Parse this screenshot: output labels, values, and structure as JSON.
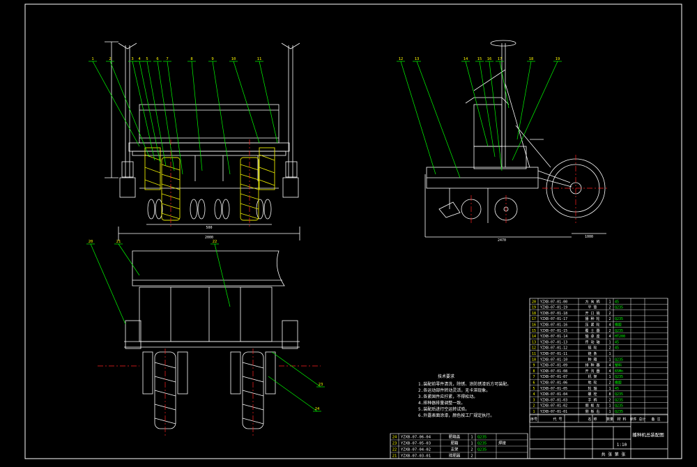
{
  "drawing": {
    "title_cell": "播种机总装配图",
    "scale_text": "1:10",
    "sheet_text": "共 张 第 张"
  },
  "tech_req": {
    "title": "技术要求",
    "lines": [
      "1.装配前零件清洗，除锈、涂防锈漆后方可装配。",
      "2.各运动部件转动灵活，无卡滞现象。",
      "3.各紧固件应拧紧，不得松动。",
      "4.排种器排量调整一致。",
      "5.装配后进行空运转试验。",
      "6.外露表面涂漆，颜色按工厂规定执行。"
    ]
  },
  "balloons": {
    "front": [
      "1",
      "2",
      "3",
      "4",
      "5",
      "6",
      "7",
      "8",
      "9",
      "10",
      "11"
    ],
    "side": [
      "12",
      "13",
      "14",
      "15",
      "16",
      "17",
      "18",
      "19"
    ],
    "bottom": [
      "20",
      "21",
      "22",
      "23",
      "24"
    ]
  },
  "parts_list": {
    "rows": [
      {
        "no": "20",
        "code": "YZXB-07-01-00",
        "name": "方 向 柄",
        "qty": "1",
        "mat": "45"
      },
      {
        "no": "19",
        "code": "YZXB-07-01-19",
        "name": "平 垫",
        "qty": "2",
        "mat": "Q235"
      },
      {
        "no": "18",
        "code": "YZXB-07-01-18",
        "name": "开 口 销",
        "qty": "2",
        "mat": ""
      },
      {
        "no": "17",
        "code": "YZXB-07-01-17",
        "name": "播 种 轮",
        "qty": "2",
        "mat": "Q235"
      },
      {
        "no": "16",
        "code": "YZXB-07-01-16",
        "name": "压 紧 轮",
        "qty": "4",
        "mat": "橡胶"
      },
      {
        "no": "15",
        "code": "YZXB-07-01-15",
        "name": "覆 土 器",
        "qty": "2",
        "mat": "Q235"
      },
      {
        "no": "14",
        "code": "YZXB-07-01-14",
        "name": "轴 承 座",
        "qty": "4",
        "mat": "HT200"
      },
      {
        "no": "13",
        "code": "YZXB-07-01-13",
        "name": "传 动 轴",
        "qty": "1",
        "mat": "45"
      },
      {
        "no": "12",
        "code": "YZXB-07-01-12",
        "name": "链 轮",
        "qty": "2",
        "mat": "45"
      },
      {
        "no": "11",
        "code": "YZXB-07-01-11",
        "name": "链 条",
        "qty": "1",
        "mat": ""
      },
      {
        "no": "10",
        "code": "YZXB-07-01-10",
        "name": "种 箱",
        "qty": "1",
        "mat": "Q235"
      },
      {
        "no": "9",
        "code": "YZXB-07-01-09",
        "name": "排 种 器",
        "qty": "4",
        "mat": "塑料"
      },
      {
        "no": "8",
        "code": "YZXB-07-01-08",
        "name": "开 沟 器",
        "qty": "4",
        "mat": "65Mn"
      },
      {
        "no": "7",
        "code": "YZXB-07-01-07",
        "name": "机 架",
        "qty": "1",
        "mat": "Q235"
      },
      {
        "no": "6",
        "code": "YZXB-07-01-06",
        "name": "地 轮",
        "qty": "2",
        "mat": "橡胶"
      },
      {
        "no": "5",
        "code": "YZXB-07-01-05",
        "name": "轮 轴",
        "qty": "1",
        "mat": "45"
      },
      {
        "no": "4",
        "code": "YZXB-07-01-04",
        "name": "螺 栓",
        "qty": "8",
        "mat": "Q235"
      },
      {
        "no": "3",
        "code": "YZXB-07-01-03",
        "name": "手 柄",
        "qty": "2",
        "mat": "Q235"
      },
      {
        "no": "2",
        "code": "YZXB-07-01-02",
        "name": "侧 板 左",
        "qty": "1",
        "mat": "Q235"
      },
      {
        "no": "1",
        "code": "YZXB-07-01-01",
        "name": "侧 板 右",
        "qty": "1",
        "mat": "Q235"
      }
    ],
    "header": {
      "no": "序号",
      "code": "代 号",
      "name": "名 称",
      "qty": "数量",
      "mat": "材 料",
      "weight": "单件 总计",
      "remark": "备 注"
    }
  },
  "bottom_list": {
    "rows": [
      {
        "no": "24",
        "code": "YZXB-07-06-04",
        "name": "肥箱盖",
        "qty": "1",
        "mat": "Q235",
        "remark": ""
      },
      {
        "no": "23",
        "code": "YZXB-07-05-03",
        "name": "肥箱",
        "qty": "1",
        "mat": "Q235",
        "remark": "焊接"
      },
      {
        "no": "22",
        "code": "YZXB-07-04-02",
        "name": "支架",
        "qty": "2",
        "mat": "Q235",
        "remark": ""
      },
      {
        "no": "21",
        "code": "YZXB-07-03-01",
        "name": "排肥器",
        "qty": "2",
        "mat": "",
        "remark": ""
      }
    ]
  },
  "dims": {
    "front_width": "2000",
    "front_inner": "500",
    "side_length": "2470",
    "side_small": "1000"
  },
  "colors": {
    "line": "#ffffff",
    "leader": "#00ff00",
    "accent": "#ffff00",
    "center": "#ff2020",
    "hatch": "#e8e800",
    "cyan": "#00e0e0"
  }
}
